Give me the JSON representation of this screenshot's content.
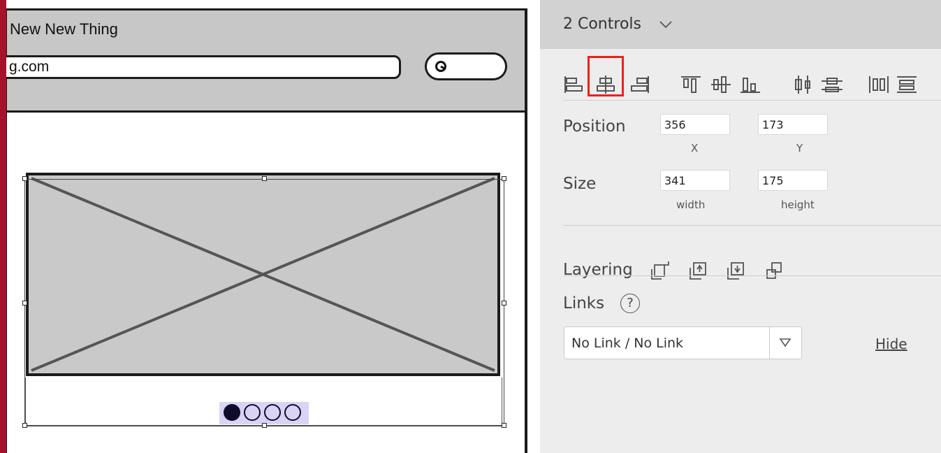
{
  "canvas": {
    "browser_title": "New New Thing",
    "url_text": "g.com",
    "pager": {
      "count": 4,
      "active_index": 0
    }
  },
  "panel": {
    "header_title": "2 Controls",
    "align_icons": [
      "align-left-icon",
      "align-center-icon",
      "align-right-icon",
      "align-top-icon",
      "align-middle-icon",
      "align-bottom-icon",
      "distribute-horizontal-icon",
      "distribute-vertical-icon",
      "space-horizontal-icon",
      "space-vertical-icon"
    ],
    "position": {
      "label": "Position",
      "x": "356",
      "y": "173",
      "x_label": "X",
      "y_label": "Y"
    },
    "size": {
      "label": "Size",
      "width": "341",
      "height": "175",
      "width_label": "width",
      "height_label": "height"
    },
    "layering": {
      "label": "Layering",
      "icons": [
        "bring-to-front-icon",
        "bring-forward-icon",
        "send-backward-icon",
        "send-to-back-icon"
      ]
    },
    "links": {
      "label": "Links",
      "help": "?",
      "select_value": "No Link / No Link",
      "hide_label": "Hide"
    }
  },
  "colors": {
    "accent": "#a6122a",
    "highlight": "#e8231a",
    "pager_bg": "#d9d4f5"
  }
}
